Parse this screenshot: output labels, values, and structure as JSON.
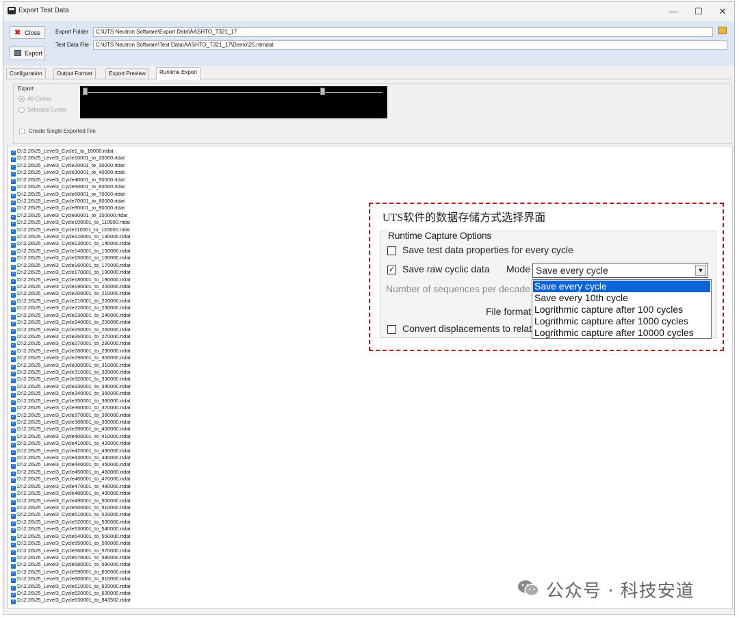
{
  "window": {
    "title": "Export Test Data",
    "controls": {
      "minimize": "—",
      "maximize": "☐",
      "close": "✕"
    }
  },
  "toolbar": {
    "close_label": "Close",
    "export_label": "Export",
    "export_folder_label": "Export Folder",
    "export_folder_value": "C:\\UTS Neutron Software\\Export Data\\AASHTO_T321_17",
    "test_data_file_label": "Test Data File",
    "test_data_file_value": "C:\\UTS Neutron Software\\Test Data\\AASHTO_T321_17\\Demo\\25.ntrndat"
  },
  "tabs": [
    {
      "label": "Configuration",
      "active": false
    },
    {
      "label": "Output Format",
      "active": false
    },
    {
      "label": "Export Preview",
      "active": false
    },
    {
      "label": "Runtime Export",
      "active": true
    }
  ],
  "export_panel": {
    "group_label": "Export",
    "all_cycles": "All Cycles",
    "selected_cycles": "Selected Cycles",
    "create_single": "Create Single Exported File"
  },
  "files": [
    "D:\\2.26\\25_Level3_Cycle1_to_10000.rtdat",
    "D:\\2.26\\25_Level3_Cycle10001_to_20000.rtdat",
    "D:\\2.26\\25_Level3_Cycle20001_to_30000.rtdat",
    "D:\\2.26\\25_Level3_Cycle30001_to_40000.rtdat",
    "D:\\2.26\\25_Level3_Cycle40001_to_50000.rtdat",
    "D:\\2.26\\25_Level3_Cycle50001_to_60000.rtdat",
    "D:\\2.26\\25_Level3_Cycle60001_to_70000.rtdat",
    "D:\\2.26\\25_Level3_Cycle70001_to_80000.rtdat",
    "D:\\2.26\\25_Level3_Cycle80001_to_90000.rtdat",
    "D:\\2.26\\25_Level3_Cycle90001_to_100000.rtdat",
    "D:\\2.26\\25_Level3_Cycle100001_to_110000.rtdat",
    "D:\\2.26\\25_Level3_Cycle110001_to_120000.rtdat",
    "D:\\2.26\\25_Level3_Cycle120001_to_130000.rtdat",
    "D:\\2.26\\25_Level3_Cycle130001_to_140000.rtdat",
    "D:\\2.26\\25_Level3_Cycle140001_to_150000.rtdat",
    "D:\\2.26\\25_Level3_Cycle150001_to_160000.rtdat",
    "D:\\2.26\\25_Level3_Cycle160001_to_170000.rtdat",
    "D:\\2.26\\25_Level3_Cycle170001_to_180000.rtdat",
    "D:\\2.26\\25_Level3_Cycle180001_to_190000.rtdat",
    "D:\\2.26\\25_Level3_Cycle190001_to_200000.rtdat",
    "D:\\2.26\\25_Level3_Cycle200001_to_210000.rtdat",
    "D:\\2.26\\25_Level3_Cycle210001_to_220000.rtdat",
    "D:\\2.26\\25_Level3_Cycle220001_to_230000.rtdat",
    "D:\\2.26\\25_Level3_Cycle230001_to_240000.rtdat",
    "D:\\2.26\\25_Level3_Cycle240001_to_250000.rtdat",
    "D:\\2.26\\25_Level3_Cycle250001_to_260000.rtdat",
    "D:\\2.26\\25_Level3_Cycle260001_to_270000.rtdat",
    "D:\\2.26\\25_Level3_Cycle270001_to_280000.rtdat",
    "D:\\2.26\\25_Level3_Cycle280001_to_290000.rtdat",
    "D:\\2.26\\25_Level3_Cycle290001_to_300000.rtdat",
    "D:\\2.26\\25_Level3_Cycle300001_to_310000.rtdat",
    "D:\\2.26\\25_Level3_Cycle310001_to_320000.rtdat",
    "D:\\2.26\\25_Level3_Cycle320001_to_330000.rtdat",
    "D:\\2.26\\25_Level3_Cycle330001_to_340000.rtdat",
    "D:\\2.26\\25_Level3_Cycle340001_to_350000.rtdat",
    "D:\\2.26\\25_Level3_Cycle350001_to_360000.rtdat",
    "D:\\2.26\\25_Level3_Cycle360001_to_370000.rtdat",
    "D:\\2.26\\25_Level3_Cycle370001_to_380000.rtdat",
    "D:\\2.26\\25_Level3_Cycle380001_to_390000.rtdat",
    "D:\\2.26\\25_Level3_Cycle390001_to_400000.rtdat",
    "D:\\2.26\\25_Level3_Cycle400001_to_410000.rtdat",
    "D:\\2.26\\25_Level3_Cycle410001_to_420000.rtdat",
    "D:\\2.26\\25_Level3_Cycle420001_to_430000.rtdat",
    "D:\\2.26\\25_Level3_Cycle430001_to_440000.rtdat",
    "D:\\2.26\\25_Level3_Cycle440001_to_450000.rtdat",
    "D:\\2.26\\25_Level3_Cycle450001_to_460000.rtdat",
    "D:\\2.26\\25_Level3_Cycle460001_to_470000.rtdat",
    "D:\\2.26\\25_Level3_Cycle470001_to_480000.rtdat",
    "D:\\2.26\\25_Level3_Cycle480001_to_490000.rtdat",
    "D:\\2.26\\25_Level3_Cycle490001_to_500000.rtdat",
    "D:\\2.26\\25_Level3_Cycle500001_to_510000.rtdat",
    "D:\\2.26\\25_Level3_Cycle510001_to_520000.rtdat",
    "D:\\2.26\\25_Level3_Cycle520001_to_530000.rtdat",
    "D:\\2.26\\25_Level3_Cycle530001_to_540000.rtdat",
    "D:\\2.26\\25_Level3_Cycle540001_to_550000.rtdat",
    "D:\\2.26\\25_Level3_Cycle550001_to_560000.rtdat",
    "D:\\2.26\\25_Level3_Cycle560001_to_570000.rtdat",
    "D:\\2.26\\25_Level3_Cycle570001_to_580000.rtdat",
    "D:\\2.26\\25_Level3_Cycle580001_to_590000.rtdat",
    "D:\\2.26\\25_Level3_Cycle590001_to_600000.rtdat",
    "D:\\2.26\\25_Level3_Cycle600001_to_610000.rtdat",
    "D:\\2.26\\25_Level3_Cycle610001_to_620000.rtdat",
    "D:\\2.26\\25_Level3_Cycle620001_to_630000.rtdat",
    "D:\\2.26\\25_Level3_Cycle630001_to_843502.rtdat"
  ],
  "callout": {
    "title": "UTS软件的数据存储方式选择界面",
    "group_label": "Runtime Capture Options",
    "save_properties": "Save test data properties for every cycle",
    "save_raw": "Save raw cyclic data",
    "mode_label": "Mode",
    "mode_value": "Save every cycle",
    "sequences_label": "Number of sequences per decade",
    "file_format_label": "File format",
    "convert_label": "Convert displacements to relativ",
    "options": [
      "Save every cycle",
      "Save every 10th cycle",
      "Logrithmic capture after 100 cycles",
      "Logrithmic capture after 1000 cycles",
      "Logrithmic capture after 10000 cycles"
    ],
    "selected_option": 0
  },
  "watermark": {
    "text": "公众号 · 科技安道",
    "icon": "wechat-icon"
  },
  "colors": {
    "accent": "#0a64d8",
    "callout_border": "#c01010",
    "checkbox_blue": "#1d6fd1"
  }
}
